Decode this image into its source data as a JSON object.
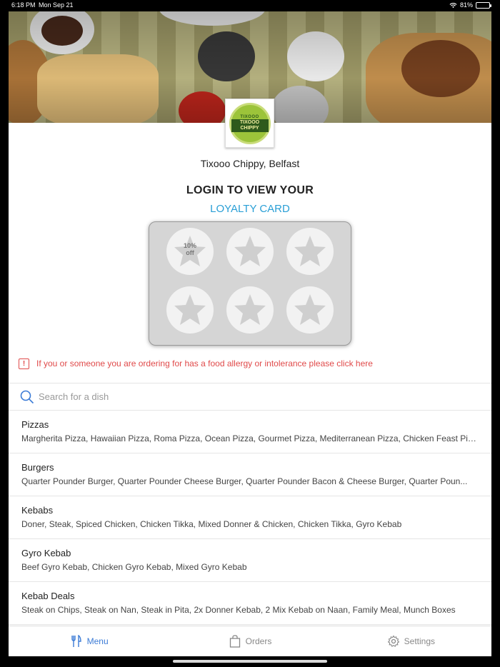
{
  "status_bar": {
    "time": "6:18 PM",
    "date": "Mon Sep 21",
    "battery": "81%",
    "battery_fraction": 0.81
  },
  "logo": {
    "top_text": "TIXOOO",
    "main_text": "TIXOOO CHIPPY"
  },
  "store": {
    "name": "Tixooo Chippy, Belfast"
  },
  "loyalty": {
    "title": "LOGIN TO VIEW YOUR",
    "subtitle": "LOYALTY CARD",
    "reward_line1": "10%",
    "reward_line2": "off"
  },
  "allergy": {
    "text": "If you or someone you are ordering for has a food allergy or intolerance please click here"
  },
  "search": {
    "placeholder": "Search for a dish"
  },
  "categories": [
    {
      "title": "Pizzas",
      "items": "Margherita Pizza, Hawaiian Pizza, Roma Pizza, Ocean Pizza, Gourmet Pizza, Mediterranean Pizza, Chicken Feast Piz..."
    },
    {
      "title": "Burgers",
      "items": "Quarter Pounder Burger, Quarter Pounder Cheese Burger, Quarter Pounder Bacon & Cheese Burger, Quarter Poun..."
    },
    {
      "title": "Kebabs",
      "items": "Doner, Steak, Spiced Chicken, Chicken Tikka, Mixed Donner & Chicken, Chicken Tikka, Gyro Kebab"
    },
    {
      "title": "Gyro Kebab",
      "items": "Beef Gyro Kebab, Chicken Gyro Kebab, Mixed Gyro Kebab"
    },
    {
      "title": "Kebab Deals",
      "items": "Steak on Chips, Steak on Nan, Steak in Pita, 2x Donner Kebab, 2 Mix Kebab on Naan, Family Meal, Munch Boxes"
    }
  ],
  "tabs": {
    "menu": "Menu",
    "orders": "Orders",
    "settings": "Settings"
  },
  "colors": {
    "accent": "#2a9fd6",
    "tab_active": "#3b7bd6",
    "warning": "#e04a4a"
  }
}
